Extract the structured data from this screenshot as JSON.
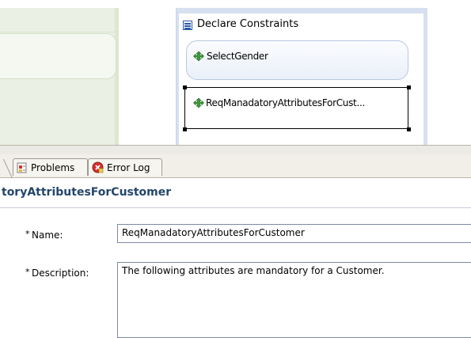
{
  "editor": {
    "constraints_title": "Declare Constraints",
    "nodes": [
      {
        "label": "SelectGender"
      },
      {
        "label": "ReqManadatoryAttributesForCust..."
      }
    ]
  },
  "tabs": [
    {
      "label": "Problems"
    },
    {
      "label": "Error Log"
    }
  ],
  "panel": {
    "title": "toryAttributesForCustomer",
    "required_marker": "*",
    "fields": {
      "name": {
        "label": "Name:",
        "value": "ReqManadatoryAttributesForCustomer"
      },
      "description": {
        "label": "Description:",
        "value": "The following attributes are mandatory for a Customer."
      }
    }
  }
}
